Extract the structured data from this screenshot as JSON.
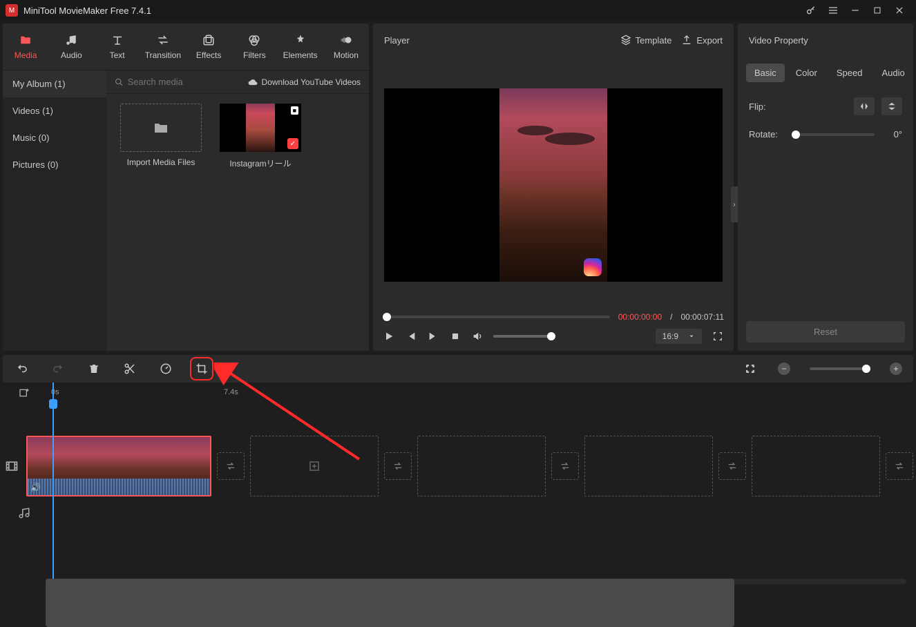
{
  "titlebar": {
    "title": "MiniTool MovieMaker Free 7.4.1"
  },
  "topTabs": [
    {
      "label": "Media"
    },
    {
      "label": "Audio"
    },
    {
      "label": "Text"
    },
    {
      "label": "Transition"
    },
    {
      "label": "Effects"
    },
    {
      "label": "Filters"
    },
    {
      "label": "Elements"
    },
    {
      "label": "Motion"
    }
  ],
  "sidebar": {
    "items": [
      {
        "label": "My Album (1)"
      },
      {
        "label": "Videos (1)"
      },
      {
        "label": "Music (0)"
      },
      {
        "label": "Pictures (0)"
      }
    ]
  },
  "mediaSearch": {
    "placeholder": "Search media"
  },
  "downloadLink": "Download YouTube Videos",
  "media": {
    "importLabel": "Import Media Files",
    "clipName": "Instagramリール"
  },
  "player": {
    "title": "Player",
    "templateLabel": "Template",
    "exportLabel": "Export",
    "timeCurrent": "00:00:00:00",
    "timeSeparator": "/",
    "timeTotal": "00:00:07:11",
    "ratio": "16:9"
  },
  "props": {
    "title": "Video Property",
    "tabs": {
      "basic": "Basic",
      "color": "Color",
      "speed": "Speed",
      "audio": "Audio"
    },
    "flipLabel": "Flip:",
    "rotateLabel": "Rotate:",
    "rotateValue": "0°",
    "reset": "Reset"
  },
  "timeline": {
    "mark0": "0s",
    "mark1": "7.4s"
  }
}
